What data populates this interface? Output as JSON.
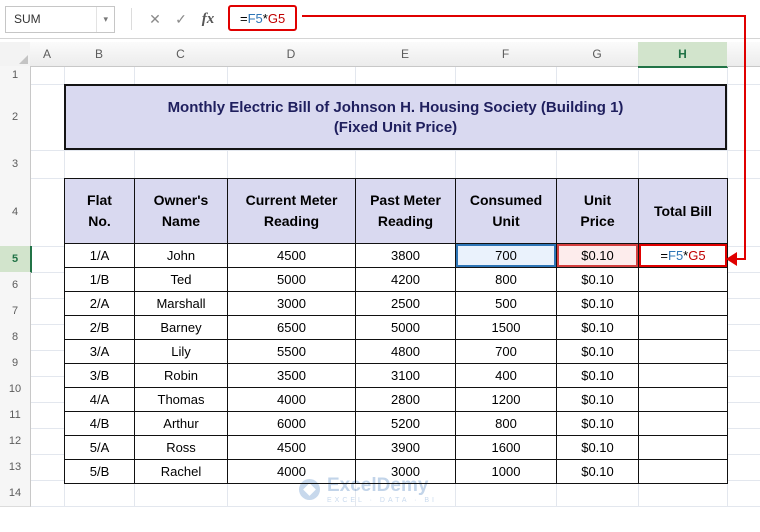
{
  "formula_bar": {
    "name_box_value": "SUM",
    "dropdown_icon": "▾",
    "cancel_icon": "✕",
    "confirm_icon": "✓",
    "fx_label": "fx",
    "formula": {
      "eq": "=",
      "ref1": "F5",
      "op": "*",
      "ref2": "G5"
    }
  },
  "sheet": {
    "column_headers": [
      "A",
      "B",
      "C",
      "D",
      "E",
      "F",
      "G",
      "H"
    ],
    "row_headers": [
      "1",
      "2",
      "3",
      "4",
      "5",
      "6",
      "7",
      "8",
      "9",
      "10",
      "11",
      "12",
      "13",
      "14"
    ],
    "active_column": "H",
    "active_row": "5"
  },
  "title": {
    "line1": "Monthly Electric Bill of Johnson H. Housing Society (Building 1)",
    "line2": "(Fixed Unit Price)"
  },
  "table": {
    "headers": [
      "Flat\nNo.",
      "Owner's\nName",
      "Current Meter\nReading",
      "Past Meter\nReading",
      "Consumed\nUnit",
      "Unit\nPrice",
      "Total Bill"
    ],
    "rows": [
      [
        "1/A",
        "John",
        "4500",
        "3800",
        "700",
        "$0.10",
        ""
      ],
      [
        "1/B",
        "Ted",
        "5000",
        "4200",
        "800",
        "$0.10",
        ""
      ],
      [
        "2/A",
        "Marshall",
        "3000",
        "2500",
        "500",
        "$0.10",
        ""
      ],
      [
        "2/B",
        "Barney",
        "6500",
        "5000",
        "1500",
        "$0.10",
        ""
      ],
      [
        "3/A",
        "Lily",
        "5500",
        "4800",
        "700",
        "$0.10",
        ""
      ],
      [
        "3/B",
        "Robin",
        "3500",
        "3100",
        "400",
        "$0.10",
        ""
      ],
      [
        "4/A",
        "Thomas",
        "4000",
        "2800",
        "1200",
        "$0.10",
        ""
      ],
      [
        "4/B",
        "Arthur",
        "6000",
        "5200",
        "800",
        "$0.10",
        ""
      ],
      [
        "5/A",
        "Ross",
        "4500",
        "3900",
        "1600",
        "$0.10",
        ""
      ],
      [
        "5/B",
        "Rachel",
        "4000",
        "3000",
        "1000",
        "$0.10",
        ""
      ]
    ],
    "active_cell_formula": {
      "eq": "=",
      "ref1": "F5",
      "op": "*",
      "ref2": "G5"
    }
  },
  "watermark": {
    "brand": "ExcelDemy",
    "tagline": "EXCEL · DATA · BI"
  },
  "colors": {
    "excel_green": "#217346",
    "annotation_red": "#e00000",
    "ref_blue": "#2e75b6",
    "ref_red": "#c00000",
    "title_bg": "#d9d9f0",
    "table_header_bg": "#d9d9f0",
    "title_text": "#1f1f5e",
    "watermark_blue": "#c2d4e9"
  }
}
